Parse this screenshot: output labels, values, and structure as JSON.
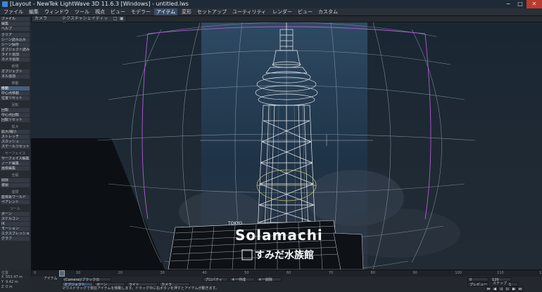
{
  "window": {
    "title": "[Layout - NewTek LightWave 3D 11.6.3 [Windows] - untitled.lws",
    "controls": [
      "−",
      "□",
      "✕"
    ]
  },
  "menubar": {
    "items": [
      "ファイル",
      "編集",
      "ウィンドウ",
      "ツール",
      "視点",
      "ビュー",
      "モデラー",
      "アイテム",
      "変形",
      "セットアップ",
      "ユーティリティ",
      "レンダー",
      "ビュー",
      "カスタム"
    ]
  },
  "viewbar": {
    "view": "カメラ",
    "mode": "テクスチャシェイディッド",
    "fields": [
      "カメラ",
      "テクスチャシェイディッド",
      "□",
      "▣"
    ]
  },
  "sidebar": {
    "top_fields": [
      "ファイル",
      "編集",
      "ヘルプ"
    ],
    "groups": [
      {
        "head": "",
        "items": [
          "クリア",
          "シーン読み込み",
          "シーン保存",
          "オブジェクト読み込み",
          "ライト追加",
          "カメラ追加"
        ]
      },
      {
        "head": "新規",
        "items": [
          "オブジェクト",
          "ヌル追加"
        ]
      },
      {
        "head": "移動",
        "items": [
          "移動",
          "中心点移動",
          "位置リセット"
        ]
      },
      {
        "head": "回転",
        "items": [
          "回転",
          "中心点回転",
          "回転リセット"
        ]
      },
      {
        "head": "拡大",
        "items": [
          "拡大/縮小",
          "ストレッチ",
          "スカッシュ",
          "スケールリセット"
        ]
      },
      {
        "head": "サーフェイス",
        "items": [
          "サーフェイス編集",
          "ノード編集",
          "画像編集"
        ]
      },
      {
        "head": "全般",
        "items": [
          "削除",
          "複製"
        ]
      },
      {
        "head": "座標",
        "items": [
          "座標系ワールド",
          "ペアレント"
        ]
      },
      {
        "head": "ツール",
        "items": [
          "ボーン",
          "スケルゴン",
          "IK",
          "モーション",
          "エクスプレッション",
          "グラフ"
        ]
      }
    ]
  },
  "timeline": {
    "ticks": [
      "0",
      "10",
      "20",
      "30",
      "40",
      "50",
      "60",
      "70",
      "80",
      "90",
      "100",
      "110",
      "120"
    ]
  },
  "position_box": {
    "head": "位置",
    "x_label": "X",
    "x_value": "553.47 m",
    "y_label": "Y",
    "y_value": "9.42 m",
    "z_label": "Z",
    "z_value": "0 m"
  },
  "bottom_bar": {
    "item_label": "アイテム",
    "item_value": "(Camera)/ブラックの",
    "object_label": "オブジェクト",
    "bones_label": "ボーン",
    "lights_label": "ライト",
    "cameras_label": "カメラ",
    "props_label": "プロパティ",
    "create_key": "キー作成",
    "delete_key": "キー削除",
    "preview": "プレビュー",
    "step_label": "ステップ",
    "step_value": "1",
    "end_frame": "120",
    "current_frame": "0",
    "status": "マウスドラッグで現在アイテムを移動します。ドラッグ中に右ボタンを押すとアイテムが動きます。"
  },
  "scene": {
    "building_logo": "Solamachi",
    "building_logo_small": "TOKYO",
    "aquarium_sign": "すみだ水族館"
  }
}
